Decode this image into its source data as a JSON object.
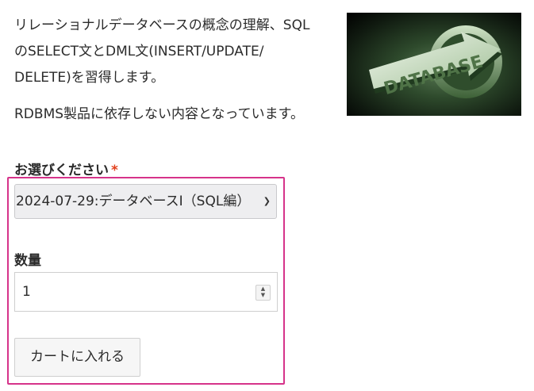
{
  "product": {
    "description_line1": "リレーショナルデータベースの概念の理解、SQL",
    "description_line2": "のSELECT文とDML文(INSERT/UPDATE/",
    "description_line3": "DELETE)を習得します。",
    "description_para2": "RDBMS製品に依存しない内容となっています。",
    "image_text": "DATABASE"
  },
  "form": {
    "select_label": "お選びください",
    "required_mark": "*",
    "selected_option": "2024-07-29:データベースⅠ（SQL編）",
    "quantity_label": "数量",
    "quantity_value": "1",
    "add_to_cart_label": "カートに入れる"
  },
  "colors": {
    "highlight_border": "#d6338a",
    "required": "#e2401c",
    "image_green": "#2e4a2c"
  }
}
